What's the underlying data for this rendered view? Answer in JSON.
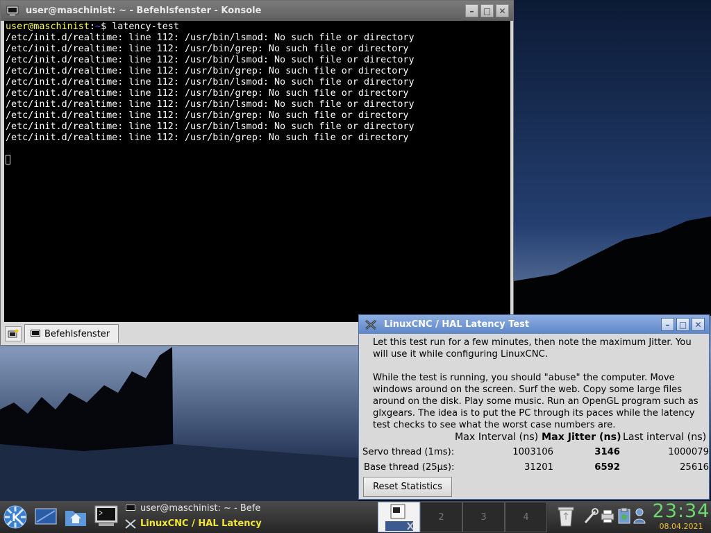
{
  "konsole": {
    "title": "user@maschinist: ~ - Befehlsfenster - Konsole",
    "prompt_user": "user@maschinist",
    "prompt_sep": ":",
    "prompt_path": "~",
    "prompt_end": "$ ",
    "command": "latency-test",
    "output_lines": [
      "/etc/init.d/realtime: line 112: /usr/bin/lsmod: No such file or directory",
      "/etc/init.d/realtime: line 112: /usr/bin/grep: No such file or directory",
      "/etc/init.d/realtime: line 112: /usr/bin/lsmod: No such file or directory",
      "/etc/init.d/realtime: line 112: /usr/bin/grep: No such file or directory",
      "/etc/init.d/realtime: line 112: /usr/bin/lsmod: No such file or directory",
      "/etc/init.d/realtime: line 112: /usr/bin/grep: No such file or directory",
      "/etc/init.d/realtime: line 112: /usr/bin/lsmod: No such file or directory",
      "/etc/init.d/realtime: line 112: /usr/bin/grep: No such file or directory",
      "/etc/init.d/realtime: line 112: /usr/bin/lsmod: No such file or directory",
      "/etc/init.d/realtime: line 112: /usr/bin/grep: No such file or directory"
    ],
    "tab_label": "Befehlsfenster"
  },
  "latency": {
    "title": "LinuxCNC / HAL Latency Test",
    "para1": "Let this test run for a few minutes, then note the maximum Jitter. You will use it while configuring LinuxCNC.",
    "para2": "While the test is running, you should \"abuse\" the computer. Move windows around on the screen. Surf the web. Copy some large files around on the disk. Play some music. Run an OpenGL program such as glxgears. The idea is to put the PC through its paces while the latency test checks to see what the worst case numbers are.",
    "headers": {
      "max_interval": "Max Interval (ns)",
      "max_jitter": "Max Jitter (ns)",
      "last_interval": "Last interval (ns)"
    },
    "rows": [
      {
        "label": "Servo thread (1ms):",
        "max_interval": "1003106",
        "max_jitter": "3146",
        "last_interval": "1000079"
      },
      {
        "label": "Base thread (25µs):",
        "max_interval": "31201",
        "max_jitter": "6592",
        "last_interval": "25616"
      }
    ],
    "reset_label": "Reset Statistics"
  },
  "taskbar": {
    "tasks": [
      {
        "label": "user@maschinist: ~ - Befe"
      },
      {
        "label": "LinuxCNC / HAL Latency"
      }
    ],
    "pager": [
      "",
      "2",
      "3",
      "4"
    ],
    "clock_time": "23:34",
    "clock_date": "08.04.2021"
  },
  "icons": {
    "start": "kde-menu-icon",
    "desktop": "show-desktop-icon",
    "home": "home-folder-icon",
    "terminal": "terminal-icon",
    "trash": "trash-icon",
    "tray": [
      "network-tools-icon",
      "printer-icon",
      "klipper-icon",
      "user-switch-icon"
    ]
  },
  "colors": {
    "terminal_bg": "#000000",
    "prompt_user": "#ffff54",
    "prompt_path": "#5454ff",
    "active_title": "#5d86c9",
    "clock_time": "#6fd86f",
    "clock_date": "#f1c33a"
  }
}
